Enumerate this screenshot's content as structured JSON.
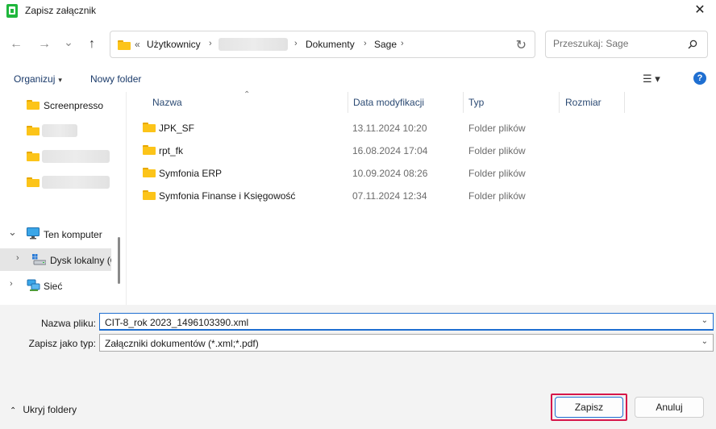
{
  "window": {
    "title": "Zapisz załącznik",
    "close_glyph": "✕"
  },
  "nav": {
    "back_glyph": "←",
    "forward_glyph": "→",
    "recent_glyph": "⌄",
    "up_glyph": "↑",
    "breadcrumb_prefix": "«",
    "breadcrumbs": [
      "Użytkownicy",
      "Dokumenty",
      "Sage"
    ],
    "separator": "›",
    "refresh_glyph": "↻"
  },
  "search": {
    "placeholder": "Przeszukaj: Sage"
  },
  "toolbar": {
    "organize_label": "Organizuj",
    "caret": "▾",
    "new_folder_label": "Nowy folder",
    "view_glyph": "☰ ▾",
    "help_glyph": "?"
  },
  "navpane": {
    "screenpresso_label": "Screenpresso",
    "this_pc_label": "Ten komputer",
    "local_disk_label": "Dysk lokalny (C",
    "network_label": "Sieć",
    "expand_glyph": "⌄",
    "collapsed_glyph": "›"
  },
  "columns": {
    "name": "Nazwa",
    "date": "Data modyfikacji",
    "type": "Typ",
    "size": "Rozmiar",
    "sort_glyph": "⌃"
  },
  "files": [
    {
      "name": "JPK_SF",
      "date": "13.11.2024 10:20",
      "type": "Folder plików"
    },
    {
      "name": "rpt_fk",
      "date": "16.08.2024 17:04",
      "type": "Folder plików"
    },
    {
      "name": "Symfonia ERP",
      "date": "10.09.2024 08:26",
      "type": "Folder plików"
    },
    {
      "name": "Symfonia Finanse i Księgowość",
      "date": "07.11.2024 12:34",
      "type": "Folder plików"
    }
  ],
  "form": {
    "filename_label": "Nazwa pliku:",
    "filename_value": "CIT-8_rok 2023_1496103390.xml",
    "filetype_label": "Zapisz jako typ:",
    "filetype_value": "Załączniki dokumentów (*.xml;*.pdf)",
    "dropdown_glyph": "⌄"
  },
  "footer": {
    "hide_folders_glyph": "⌃",
    "hide_folders_label": "Ukryj foldery",
    "save_label": "Zapisz",
    "cancel_label": "Anuluj"
  },
  "colors": {
    "accent": "#1f6fd1",
    "highlight": "#d6174a",
    "folder": "#fcc419"
  }
}
